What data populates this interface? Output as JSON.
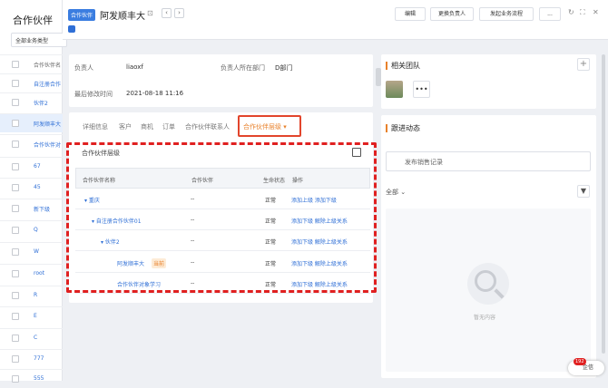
{
  "left": {
    "title": "合作伙伴",
    "filter": "全部业务类型",
    "header": "合作伙伴名",
    "items": [
      "自注册合作",
      "伙伴2",
      "阿发顺丰大",
      "合作伙伴对",
      "67",
      "45",
      "新下级",
      "Q",
      "W",
      "root",
      "R",
      "E",
      "C",
      "777",
      "555"
    ]
  },
  "header": {
    "tag": "合作伙伴",
    "name": "阿发顺丰大",
    "buttons": [
      "编辑",
      "更换负责人",
      "发起业务流程",
      "..."
    ]
  },
  "info": {
    "owner_label": "负责人",
    "owner": "liaoxf",
    "dept_label": "负责人所在部门",
    "dept": "D部门",
    "modified_label": "最后修改时间",
    "modified": "2021-08-18 11:16"
  },
  "tabs": [
    "详细信息",
    "客户",
    "商机",
    "订单",
    "合作伙伴联系人",
    "合作伙伴层级 ▾"
  ],
  "hierarchy": {
    "title": "合作伙伴层级",
    "columns": [
      "合作伙伴名称",
      "合作伙伴",
      "生命状态",
      "操作"
    ],
    "rows": [
      {
        "name": "▾ 重庆",
        "partner": "--",
        "status": "正常",
        "actions": "添加上级  添加下级"
      },
      {
        "name": "▾ 自注册合作伙伴01",
        "partner": "--",
        "status": "正常",
        "actions": "添加下级  解除上级关系"
      },
      {
        "name": "▾ 伙伴2",
        "partner": "--",
        "status": "正常",
        "actions": "添加下级  解除上级关系"
      },
      {
        "name": "阿发顺丰大",
        "current": "当前",
        "partner": "--",
        "status": "正常",
        "actions": "添加下级  解除上级关系"
      },
      {
        "name": "合作伙伴对象学习",
        "partner": "--",
        "status": "正常",
        "actions": "添加下级  解除上级关系"
      }
    ]
  },
  "right": {
    "team_title": "相关团队",
    "follow_title": "跟进动态",
    "input_placeholder": "发布销售记录",
    "filter_all": "全部 ⌄",
    "empty_text": "暂无内容"
  },
  "qiyu": {
    "count": "192",
    "label": "企信"
  }
}
